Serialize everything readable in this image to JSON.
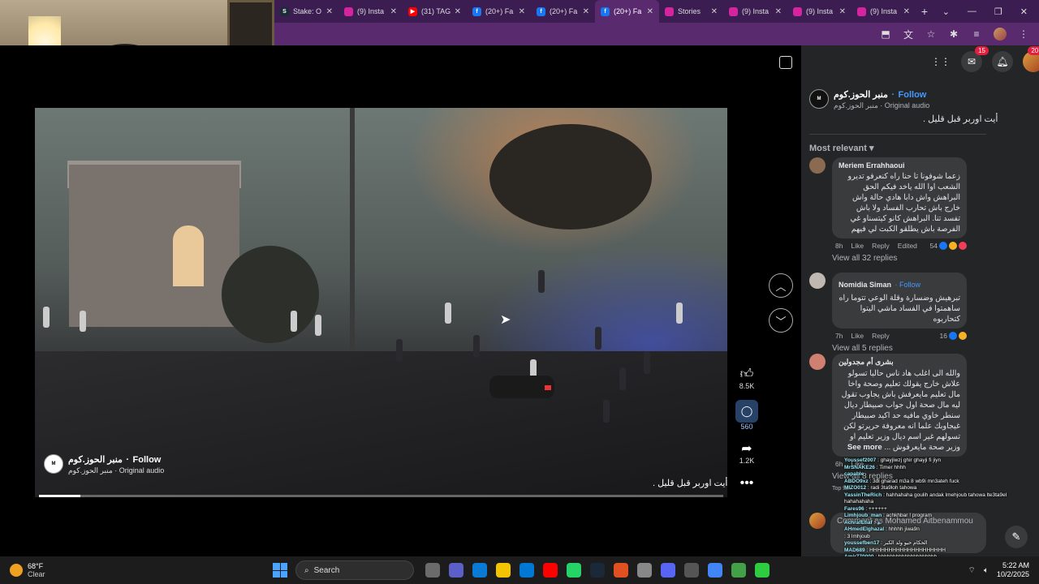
{
  "browser": {
    "tabs": [
      {
        "label": "Stake: O",
        "color": "#1a2c38",
        "glyph": "S",
        "active": false
      },
      {
        "label": "(9) Insta",
        "color": "#d6249f",
        "glyph": "",
        "active": false
      },
      {
        "label": "(31) TAG",
        "color": "#ff0000",
        "glyph": "▶",
        "active": false
      },
      {
        "label": "(20+) Fa",
        "color": "#1877f2",
        "glyph": "f",
        "active": false
      },
      {
        "label": "(20+) Fa",
        "color": "#1877f2",
        "glyph": "f",
        "active": false
      },
      {
        "label": "(20+) Fa",
        "color": "#1877f2",
        "glyph": "f",
        "active": true
      },
      {
        "label": "Stories",
        "color": "#d6249f",
        "glyph": "",
        "active": false
      },
      {
        "label": "(9) Insta",
        "color": "#d6249f",
        "glyph": "",
        "active": false
      },
      {
        "label": "(9) Insta",
        "color": "#d6249f",
        "glyph": "",
        "active": false
      },
      {
        "label": "(9) Insta",
        "color": "#d6249f",
        "glyph": "",
        "active": false
      }
    ],
    "new_tab": "+",
    "window_controls": [
      "⌄",
      "—",
      "❐",
      "✕"
    ]
  },
  "video": {
    "page_name": "منبر الحوز.كوم",
    "follow_label": "Follow",
    "audio": "منبر الحوز.كوم · Original audio",
    "logo_text": "M",
    "caption": "أيت اوربر قبل قليل .",
    "progress_fraction": 0.06,
    "likes": "8.5K",
    "comments": "560",
    "shares": "1.2K",
    "more": "•••"
  },
  "topbar": {
    "messenger_badge": "15",
    "notif_badge": "20+"
  },
  "post": {
    "page_name": "منبر الحوز.كوم",
    "follow_label": "Follow",
    "audio": "منبر الحوز.كوم · Original audio",
    "caption": "أيت اوربر قبل قليل .",
    "sort_label": "Most relevant"
  },
  "comments": [
    {
      "author": "Meriem Errahhaoui",
      "follow": "",
      "text": "زعما شوفونا تا حنا راه كنعرفو تديرو الشعب اوا الله ياخد فيكم الحق البراهش واش دابا هادي حالة واش خارج باش تحارب الفساد ولا باش تفسد تنا. البراهش كانو كيتسناو غي الفرصة باش يطلقو الكبت لي فيهم",
      "time": "8h",
      "like": "Like",
      "reply": "Reply",
      "edited": "Edited",
      "react_count": "54",
      "view_replies": "View all 32 replies",
      "avatar": "#8a6a50"
    },
    {
      "author": "Nomidia Siman",
      "follow": "· Follow",
      "text": "تبرهيش وضسارة وقلة الوعي تتوما راه ساهمتوا في الفساد ماشي اليتوا كتحاربوه",
      "time": "7h",
      "like": "Like",
      "reply": "Reply",
      "edited": "",
      "react_count": "16",
      "view_replies": "View all 5 replies",
      "avatar": "#c0b8b0"
    },
    {
      "author": "بشرى أم مجدولين",
      "follow": "",
      "text": "والله الى اغلب هاد ناس حاليا تسولو علاش خارج يقولك تعليم وصحة واخا مال تعليم مايعرفش باش يجاوب تقول ليه مال صحة اول جواب صبيطار ديال سنطر خاوي مافيه حد اكيد صبيطار غيجاوبك علما انه معروفة حريرتو لكن تسولهم غير اسم ديال وزير تعليم او وزير صحة مايعرفوش ...",
      "see_more": "See more",
      "time": "6h",
      "like": "Like",
      "reply": "",
      "edited": "",
      "react_count": "",
      "view_replies": "View all 8 replies",
      "avatar": "#d08070"
    }
  ],
  "top_fan_label": "Top fan",
  "comment_placeholder": "Comment as Mohamed Aitbenammou",
  "stream_chat": [
    {
      "user": "Youssef2007",
      "msg": ": ghayjiwzj ghir ghayji fi jiyn"
    },
    {
      "user": "MrSNAKE26",
      "msg": ": Timer hhhh"
    },
    {
      "user": "capable",
      "msg": ""
    },
    {
      "user": "ABDO9xz",
      "msg": ": 3dl gharad m3a 8 wb9i mn3ateh fuck"
    },
    {
      "user": "MIZO012",
      "msg": ": radi 3ta9loh tahowa"
    },
    {
      "user": "YassinTheRich",
      "msg": ": hahhahaha goulih andak lmehjoub tahowa lte3ta9el hahahahaha"
    },
    {
      "user": "Fares96",
      "msg": ": ++++++"
    },
    {
      "user": "Limhjoub_man",
      "msg": ": achkhbar ! program"
    },
    {
      "user": "AchrafEtiaf",
      "msg": ": 🔊"
    },
    {
      "user": "AHmedElghazal",
      "msg": ": hhhhh jiwa9n"
    },
    {
      "user": "",
      "msg": ": 3 lmhjoub"
    },
    {
      "user": "youssefben17",
      "msg": ": الحكام حيو ولد الكبر"
    },
    {
      "user": "MAD689",
      "msg": ": HHHHHHHHHHHHHHHHHHHH"
    },
    {
      "user": "Amir770000",
      "msg": ": hhhhhhhhhhhhhhhhhhhh"
    }
  ],
  "taskbar": {
    "temp": "68°F",
    "condition": "Clear",
    "search": "Search",
    "time": "5:22 AM",
    "date": "10/2/2025",
    "apps": [
      "#6b6b6b",
      "#5b5fc7",
      "#0a7bd4",
      "#f5c400",
      "#0078d4",
      "#ff0000",
      "#25d366",
      "#1b2838",
      "#e05020",
      "#888888",
      "#5865f2",
      "#555555",
      "#4285f4",
      "#43a047",
      "#2ecc40"
    ]
  }
}
